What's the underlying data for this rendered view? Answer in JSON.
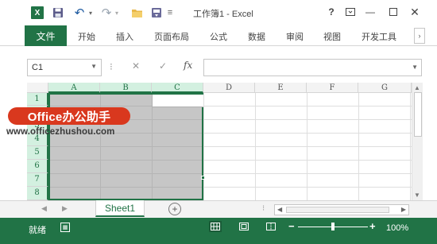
{
  "titlebar": {
    "app_icon": "X",
    "title": "工作簿1 - Excel",
    "help": "?",
    "icons": [
      "excel-logo-icon",
      "save-icon",
      "undo-icon",
      "redo-icon",
      "open-folder-icon",
      "quick-access-icon",
      "customize-dropdown-icon",
      "help-icon",
      "ribbon-display-options-icon",
      "minimize-icon",
      "maximize-icon",
      "close-icon"
    ]
  },
  "ribbon": {
    "file_tab": "文件",
    "tabs": [
      "开始",
      "插入",
      "页面布局",
      "公式",
      "数据",
      "审阅",
      "视图",
      "开发工具"
    ],
    "scroll": "›"
  },
  "formula_bar": {
    "name_box": "C1",
    "fx": "fx",
    "formula": ""
  },
  "grid": {
    "columns": [
      "A",
      "B",
      "C",
      "D",
      "E",
      "F",
      "G"
    ],
    "selected_columns": [
      "A",
      "B",
      "C"
    ],
    "rows": [
      "1",
      "2",
      "3",
      "4",
      "5",
      "6",
      "7",
      "8"
    ],
    "selected_rows": [
      "1",
      "2",
      "3",
      "4",
      "5",
      "6",
      "7",
      "8"
    ],
    "active_cell": "C1",
    "selection": "A1:C8"
  },
  "watermark": {
    "badge": "Office办公助手",
    "url": "www.officezhushou.com"
  },
  "sheets": {
    "active": "Sheet1",
    "add": "+"
  },
  "status": {
    "text": "就绪",
    "zoom": "100%",
    "zoom_level_percent": 100
  },
  "colors": {
    "accent": "#217346",
    "selection_fill": "#c6c6c6",
    "header_selected": "#d3f0e0",
    "watermark_badge": "#d9381e"
  }
}
